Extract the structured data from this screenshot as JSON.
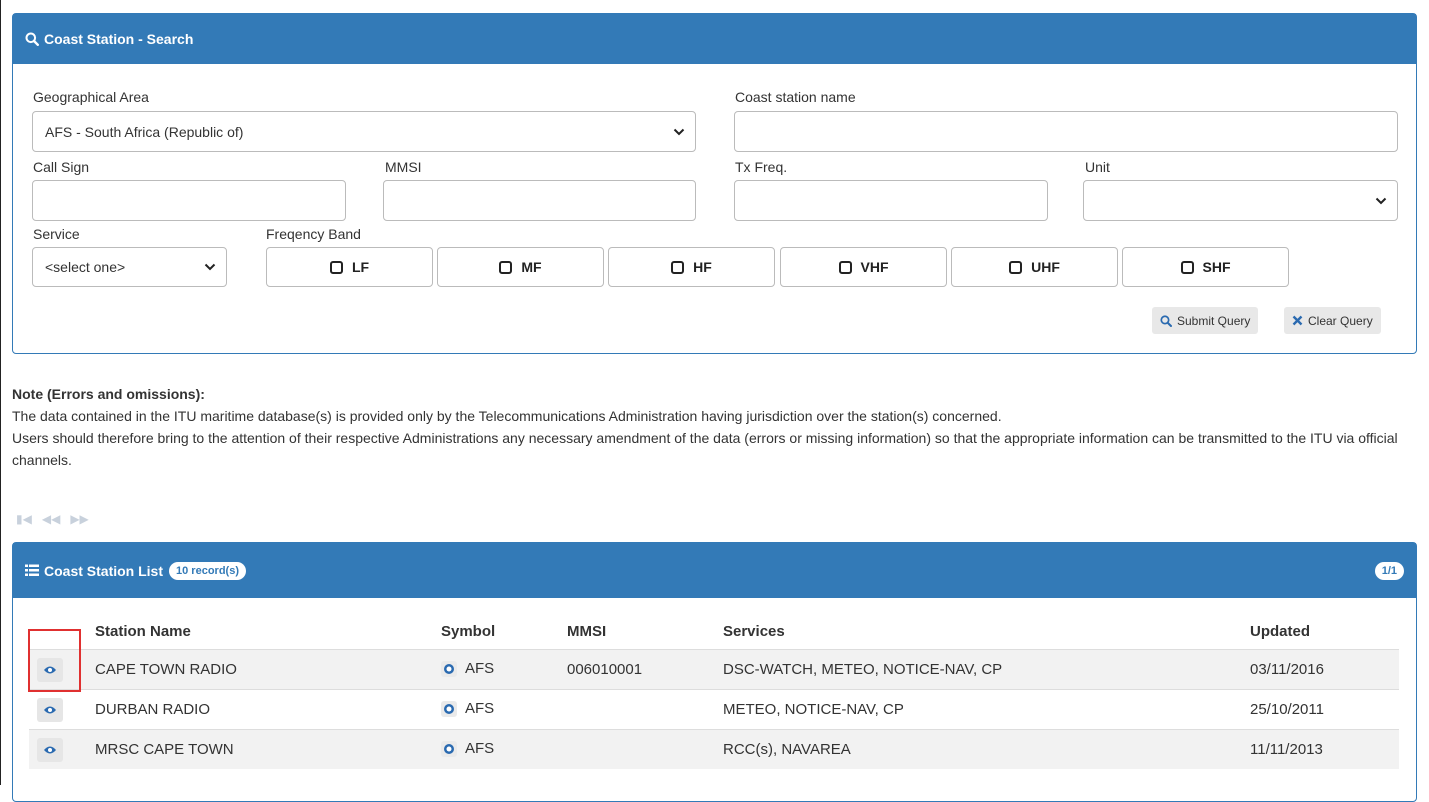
{
  "search": {
    "title": "Coast Station - Search",
    "geo_label": "Geographical Area",
    "geo_value": "AFS - South Africa (Republic of)",
    "station_name_label": "Coast station name",
    "station_name_value": "",
    "call_sign_label": "Call Sign",
    "mmsi_label": "MMSI",
    "tx_freq_label": "Tx Freq.",
    "unit_label": "Unit",
    "service_label": "Service",
    "service_value": "<select one>",
    "band_label": "Freqency Band",
    "bands": [
      "LF",
      "MF",
      "HF",
      "VHF",
      "UHF",
      "SHF"
    ],
    "submit_label": "Submit Query",
    "clear_label": "Clear Query"
  },
  "note": {
    "title": "Note (Errors and omissions):",
    "line1": "The data contained in the ITU maritime database(s) is provided only by the Telecommunications Administration having jurisdiction over the station(s) concerned.",
    "line2": "Users should therefore bring to the attention of their respective Administrations any necessary amendment of the data (errors or missing information) so that the appropriate information can be transmitted to the ITU via official channels."
  },
  "list": {
    "title": "Coast Station List",
    "records_badge": "10 record(s)",
    "page_badge": "1/1",
    "columns": [
      "Station Name",
      "Symbol",
      "MMSI",
      "Services",
      "Updated"
    ],
    "rows": [
      {
        "name": "CAPE TOWN RADIO",
        "symbol": "AFS",
        "mmsi": "006010001",
        "services": "DSC-WATCH, METEO, NOTICE-NAV, CP",
        "updated": "03/11/2016"
      },
      {
        "name": "DURBAN RADIO",
        "symbol": "AFS",
        "mmsi": "",
        "services": "METEO, NOTICE-NAV, CP",
        "updated": "25/10/2011"
      },
      {
        "name": "MRSC CAPE TOWN",
        "symbol": "AFS",
        "mmsi": "",
        "services": "RCC(s), NAVAREA",
        "updated": "11/11/2013"
      }
    ]
  },
  "colors": {
    "primary": "#337ab7",
    "highlight": "#e03030"
  }
}
